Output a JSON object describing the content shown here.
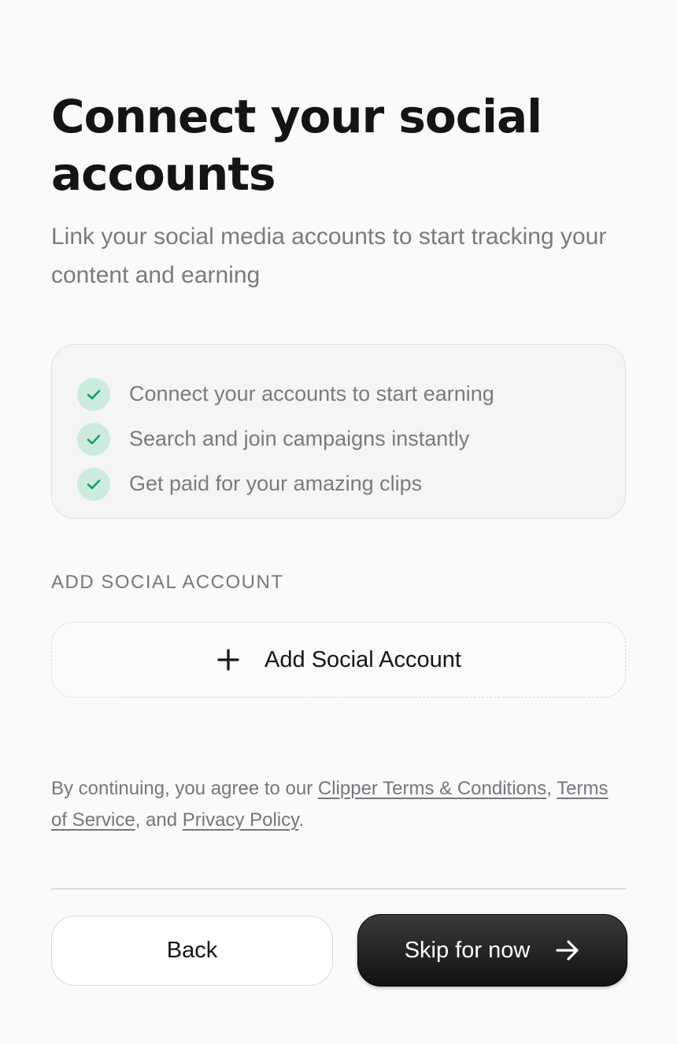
{
  "header": {
    "title": "Connect your social accounts",
    "subtitle": "Link your social media accounts to start tracking your content and earning"
  },
  "features": {
    "items": [
      {
        "text": "Connect your accounts to start earning",
        "icon": "check-icon"
      },
      {
        "text": "Search and join campaigns instantly",
        "icon": "check-icon"
      },
      {
        "text": "Get paid for your amazing clips",
        "icon": "check-icon"
      }
    ]
  },
  "social": {
    "section_label": "ADD SOCIAL ACCOUNT",
    "add_button_label": "Add Social Account",
    "add_icon": "plus-icon"
  },
  "legal": {
    "prefix": "By continuing, you agree to our ",
    "clipper_terms": "Clipper Terms & Conditions",
    "sep1": ", ",
    "terms_of_service": "Terms of Service",
    "sep2": ", and ",
    "privacy_policy": "Privacy Policy",
    "suffix": "."
  },
  "footer": {
    "back_label": "Back",
    "skip_label": "Skip for now",
    "skip_icon": "arrow-right-icon"
  },
  "colors": {
    "check_bg": "#cdeadf",
    "check_stroke": "#1a9e6a",
    "primary_button": "#1a1a1a",
    "muted_text": "#7a7b80"
  }
}
